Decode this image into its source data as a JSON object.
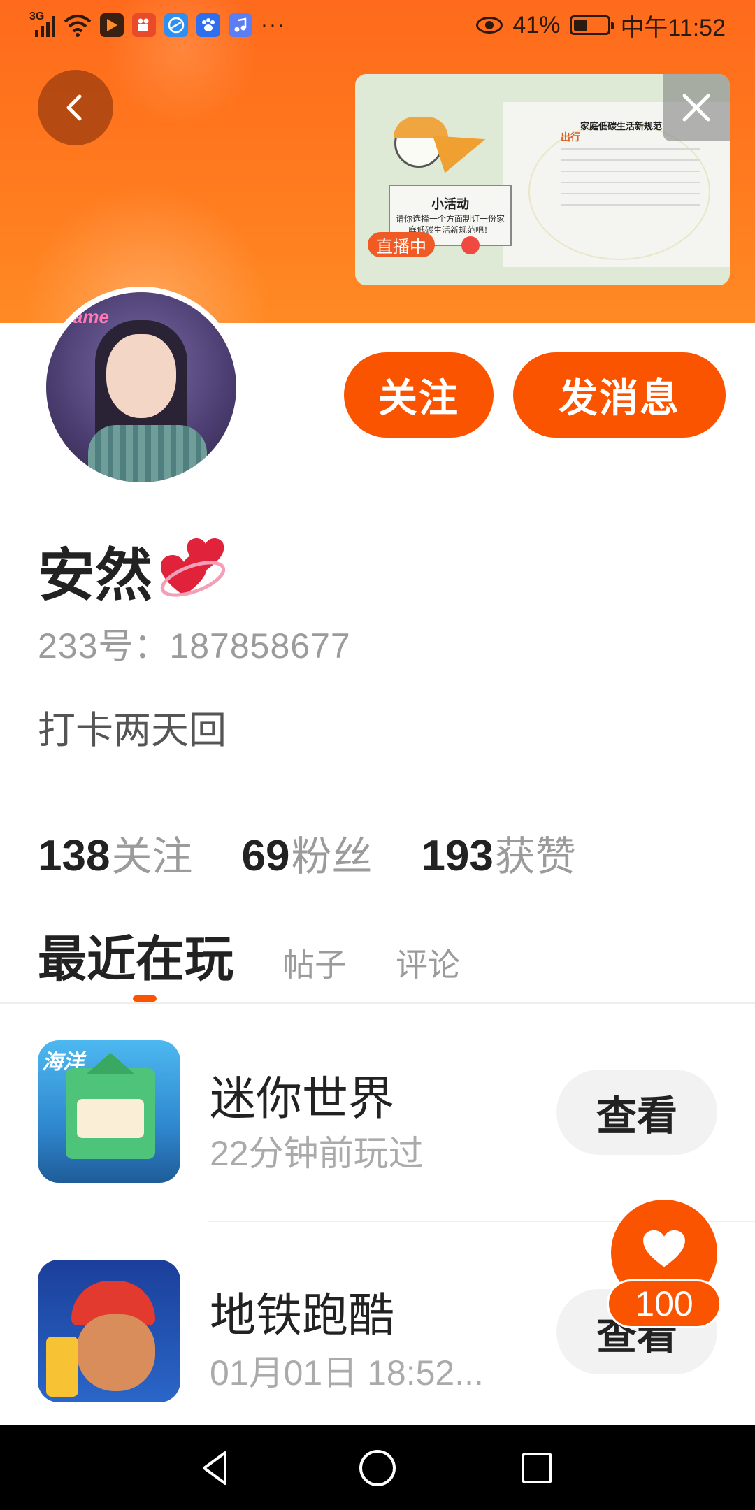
{
  "status_bar": {
    "network": "3G",
    "battery_percent": "41%",
    "time": "中午11:52",
    "more_indicator": "···",
    "icons": [
      "signal-icon",
      "wifi-icon",
      "video-app-icon",
      "kuaishou-app-icon",
      "browser-app-icon",
      "baidu-app-icon",
      "music-app-icon",
      "eye-care-icon",
      "battery-icon"
    ]
  },
  "live_preview": {
    "badge": "直播中",
    "card_title": "小活动",
    "card_text": "请你选择一个方面制订一份家庭低碳生活新规范吧！",
    "doc_title": "家庭低碳生活新规范",
    "doc_subtitle": "出行"
  },
  "profile": {
    "nickname": "安然",
    "uid_label": "233号：187858677",
    "bio": "打卡两天回",
    "follow_button": "关注",
    "message_button": "发消息"
  },
  "stats": [
    {
      "num": "138",
      "label": "关注"
    },
    {
      "num": "69",
      "label": "粉丝"
    },
    {
      "num": "193",
      "label": "获赞"
    }
  ],
  "tabs": {
    "active": "最近在玩",
    "posts": "帖子",
    "comments": "评论"
  },
  "games": [
    {
      "title": "迷你世界",
      "subtitle": "22分钟前玩过",
      "button": "查看",
      "icon_text": "海洋"
    },
    {
      "title": "地铁跑酷",
      "subtitle": "01月01日 18:52...",
      "button": "查看"
    }
  ],
  "like_fab": {
    "count": "100"
  },
  "colors": {
    "accent": "#fa5400",
    "banner": "#ff7a1e"
  }
}
